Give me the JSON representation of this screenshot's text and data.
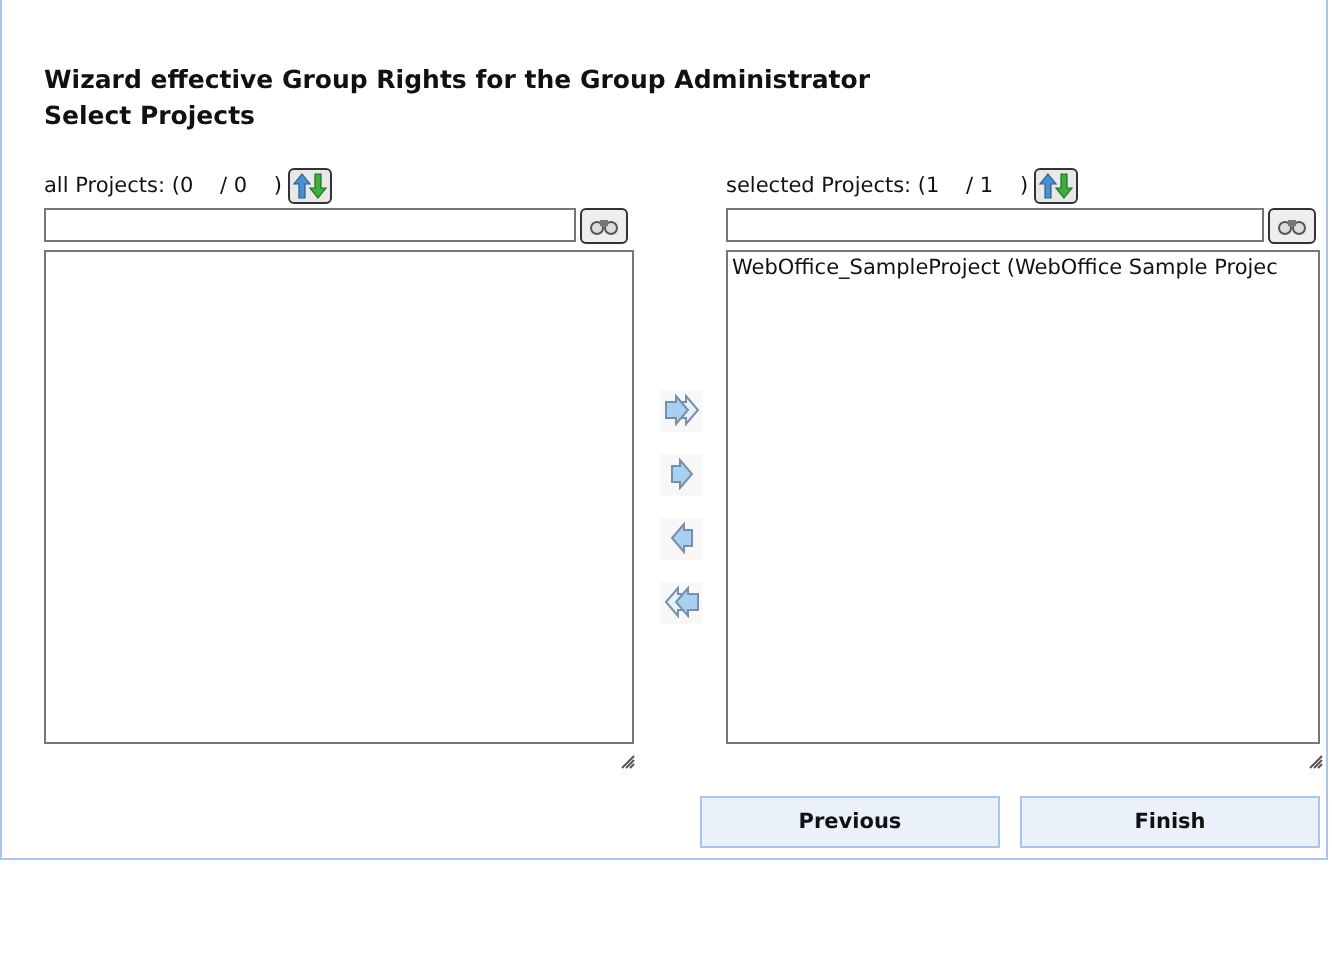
{
  "title": "Wizard effective Group Rights for the Group Administrator",
  "subtitle": "Select Projects",
  "lists": [
    {
      "label": "all Projects: (0    / 0    )"
    },
    {
      "label": "selected Projects: (1    / 1    )",
      "items": [
        "WebOffice_SampleProject (WebOffice Sample Projec"
      ]
    }
  ],
  "buttons": [
    "Previous",
    "Finish"
  ]
}
